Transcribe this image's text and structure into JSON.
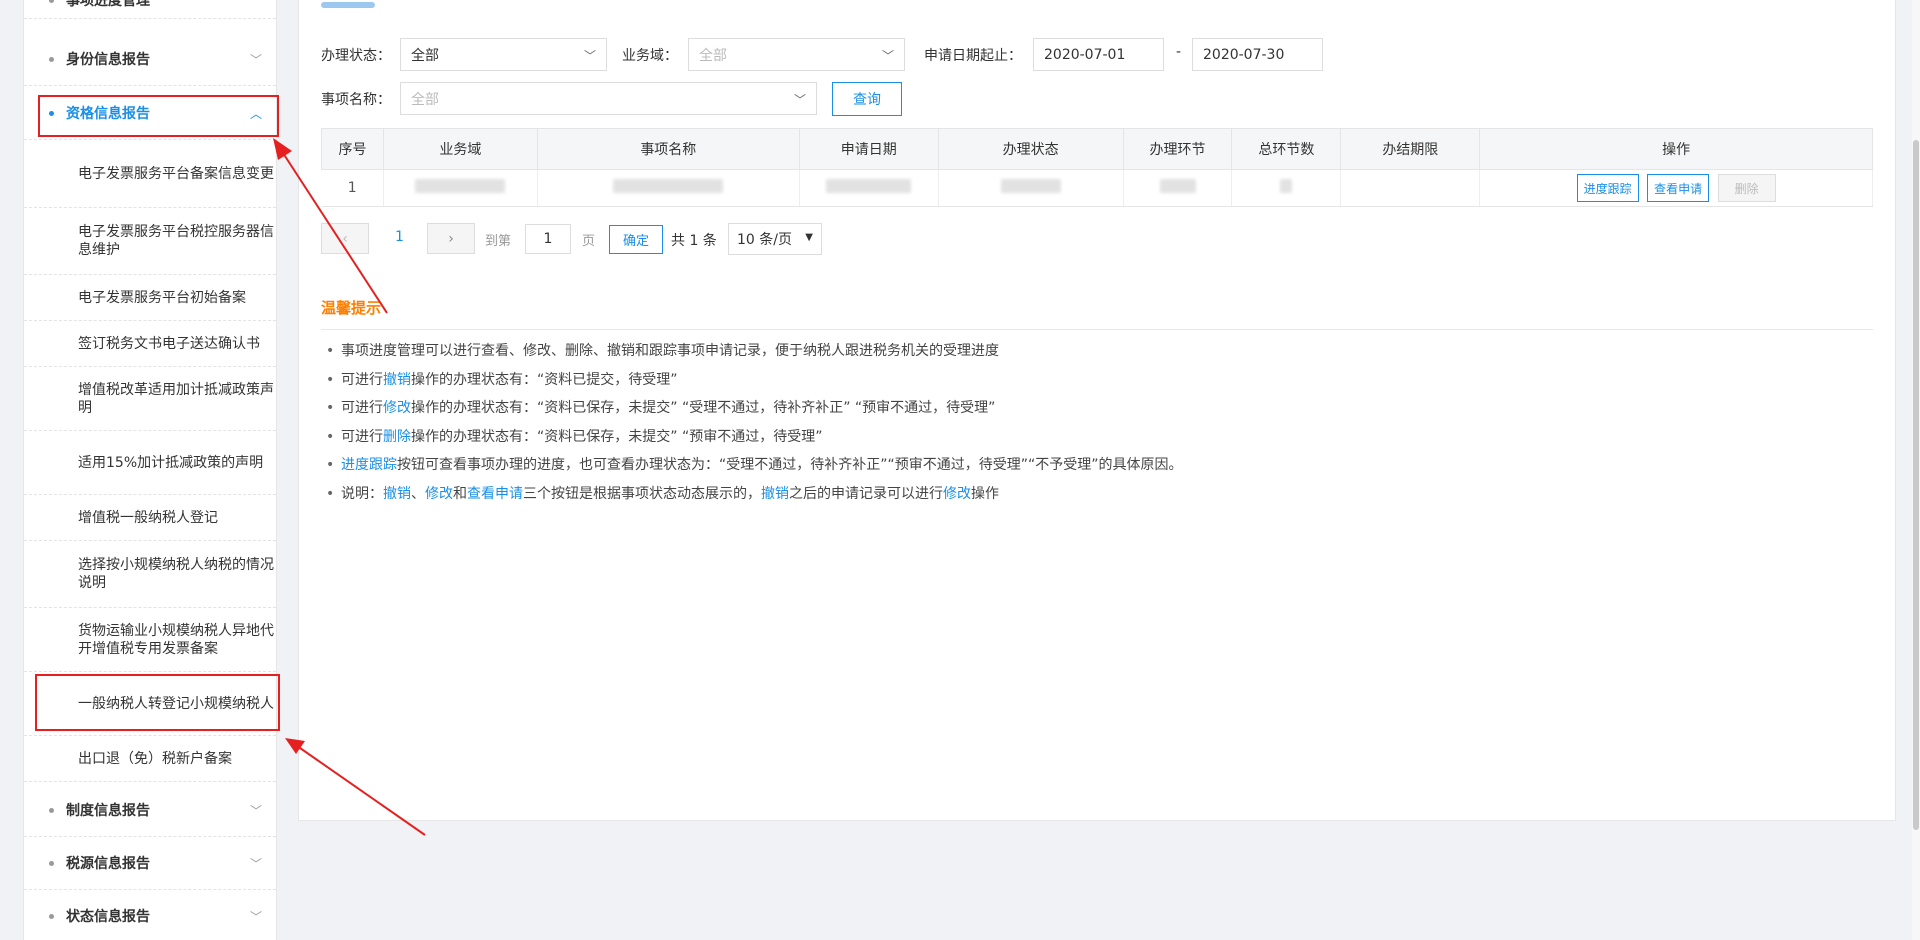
{
  "sidebar": {
    "groups": [
      {
        "label": "事项进度管理"
      },
      {
        "label": "身份信息报告"
      },
      {
        "label": "资格信息报告"
      },
      {
        "label": "制度信息报告"
      },
      {
        "label": "税源信息报告"
      },
      {
        "label": "状态信息报告"
      }
    ],
    "subitems": [
      {
        "label": "电子发票服务平台备案信息变更"
      },
      {
        "label": "电子发票服务平台税控服务器信息维护"
      },
      {
        "label": "电子发票服务平台初始备案"
      },
      {
        "label": "签订税务文书电子送达确认书"
      },
      {
        "label": "增值税改革适用加计抵减政策声明"
      },
      {
        "label": "适用15%加计抵减政策的声明"
      },
      {
        "label": "增值税一般纳税人登记"
      },
      {
        "label": "选择按小规模纳税人纳税的情况说明"
      },
      {
        "label": "货物运输业小规模纳税人异地代开增值税专用发票备案"
      },
      {
        "label": "一般纳税人转登记小规模纳税人"
      },
      {
        "label": "出口退（免）税新户备案"
      }
    ]
  },
  "filters": {
    "status_label": "办理状态：",
    "status_value": "全部",
    "domain_label": "业务域：",
    "domain_placeholder": "全部",
    "date_label": "申请日期起止：",
    "date_start": "2020-07-01",
    "date_sep": "-",
    "date_end": "2020-07-30",
    "name_label": "事项名称：",
    "name_placeholder": "全部",
    "query_button": "查询"
  },
  "table": {
    "headers": [
      "序号",
      "业务域",
      "事项名称",
      "申请日期",
      "办理状态",
      "办理环节",
      "总环节数",
      "办结期限",
      "操作"
    ],
    "rows": [
      {
        "index": "1",
        "actions": [
          "进度跟踪",
          "查看申请",
          "删除"
        ]
      }
    ]
  },
  "pagination": {
    "prev": "‹",
    "current": "1",
    "next": "›",
    "goto_label": "到第",
    "page_input": "1",
    "page_unit": "页",
    "confirm": "确定",
    "total": "共 1 条",
    "page_size": "10 条/页"
  },
  "tips": {
    "title": "温馨提示",
    "items": [
      {
        "parts": [
          {
            "t": "事项进度管理可以进行查看、修改、删除、撤销和跟踪事项申请记录，便于纳税人跟进税务机关的受理进度"
          }
        ]
      },
      {
        "parts": [
          {
            "t": "可进行"
          },
          {
            "t": "撤销",
            "h": 1
          },
          {
            "t": "操作的办理状态有：“资料已提交，待受理”"
          }
        ]
      },
      {
        "parts": [
          {
            "t": "可进行"
          },
          {
            "t": "修改",
            "h": 1
          },
          {
            "t": "操作的办理状态有：“资料已保存，未提交” “受理不通过，待补齐补正” “预审不通过，待受理”"
          }
        ]
      },
      {
        "parts": [
          {
            "t": "可进行"
          },
          {
            "t": "删除",
            "h": 1
          },
          {
            "t": "操作的办理状态有：“资料已保存，未提交” “预审不通过，待受理”"
          }
        ]
      },
      {
        "parts": [
          {
            "t": "进度跟踪",
            "h": 1
          },
          {
            "t": "按钮可查看事项办理的进度，也可查看办理状态为：“受理不通过，待补齐补正”“预审不通过，待受理”“不予受理”的具体原因。"
          }
        ]
      },
      {
        "parts": [
          {
            "t": "说明："
          },
          {
            "t": "撤销",
            "h": 1
          },
          {
            "t": "、"
          },
          {
            "t": "修改",
            "h": 1
          },
          {
            "t": "和"
          },
          {
            "t": "查看申请",
            "h": 1
          },
          {
            "t": "三个按钮是根据事项状态动态展示的，"
          },
          {
            "t": "撤销",
            "h": 1
          },
          {
            "t": "之后的申请记录可以进行"
          },
          {
            "t": "修改",
            "h": 1
          },
          {
            "t": "操作"
          }
        ]
      }
    ]
  },
  "colors": {
    "accent": "#1a8fe8",
    "annotation": "#e62020",
    "tip_title": "#ff7f00"
  }
}
